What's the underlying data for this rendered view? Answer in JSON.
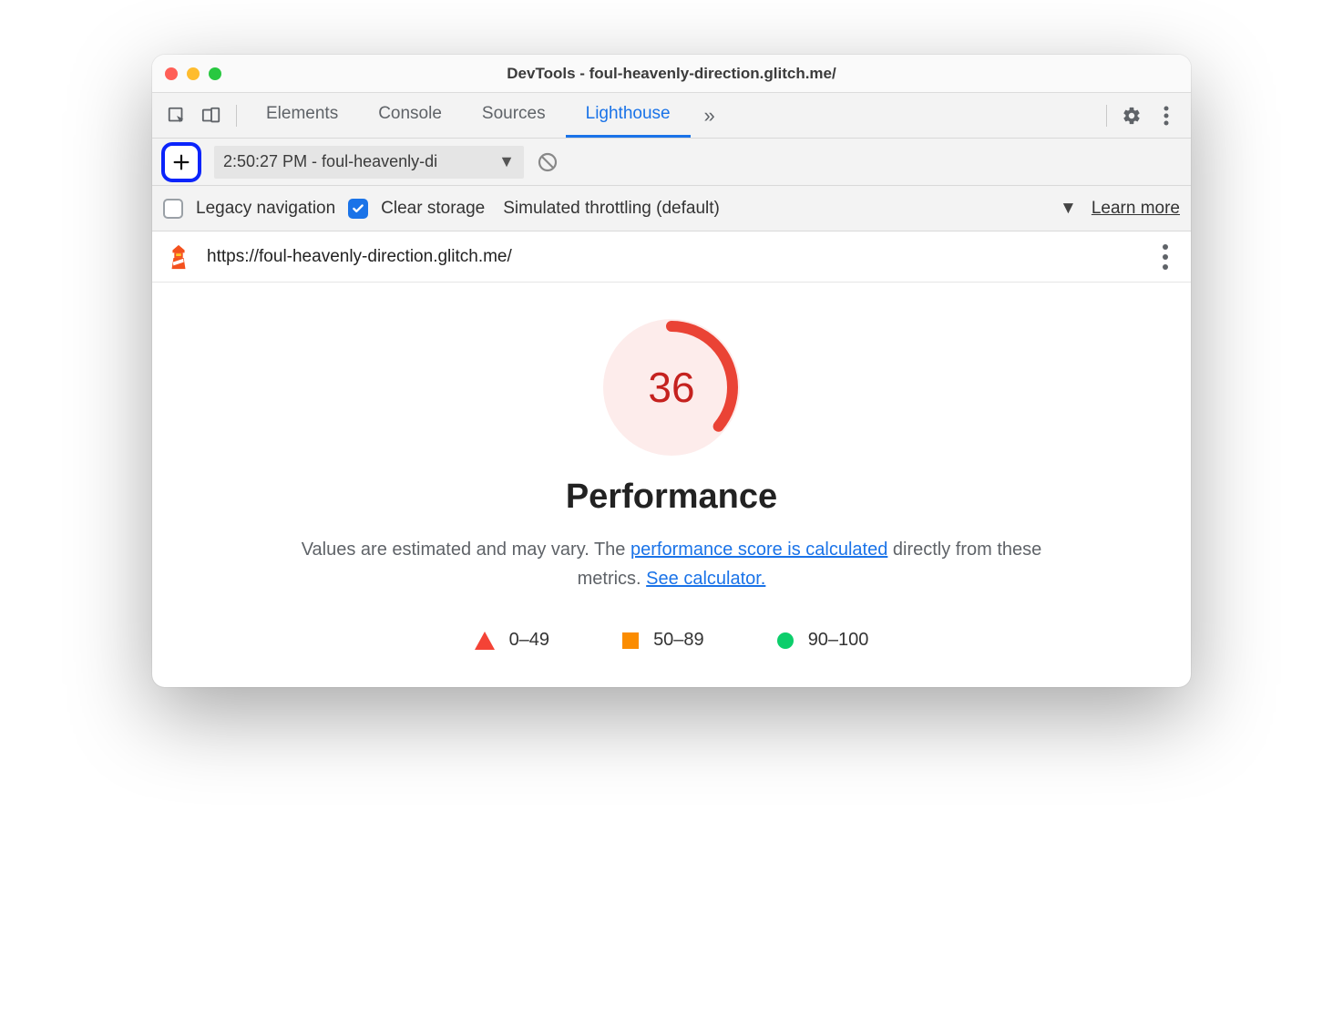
{
  "window": {
    "title": "DevTools - foul-heavenly-direction.glitch.me/"
  },
  "tabs": {
    "items": [
      "Elements",
      "Console",
      "Sources",
      "Lighthouse"
    ],
    "activeIndex": 3
  },
  "lighthouse_toolbar": {
    "report_select": "2:50:27 PM - foul-heavenly-di"
  },
  "options": {
    "legacy_label": "Legacy navigation",
    "legacy_checked": false,
    "clear_label": "Clear storage",
    "clear_checked": true,
    "throttling_label": "Simulated throttling (default)",
    "learn_more": "Learn more"
  },
  "report": {
    "url": "https://foul-heavenly-direction.glitch.me/",
    "score": "36",
    "score_pct": 36,
    "category": "Performance",
    "desc_prefix": "Values are estimated and may vary. The ",
    "desc_link1": "performance score is calculated",
    "desc_middle": " directly from these metrics. ",
    "desc_link2": "See calculator.",
    "legend": {
      "bad": "0–49",
      "mid": "50–89",
      "good": "90–100"
    },
    "colors": {
      "fail": "#c5221f",
      "fail_arc": "#ea4335",
      "warn": "#fb8c00",
      "pass": "#0cce6b",
      "link": "#1a73e8"
    }
  }
}
